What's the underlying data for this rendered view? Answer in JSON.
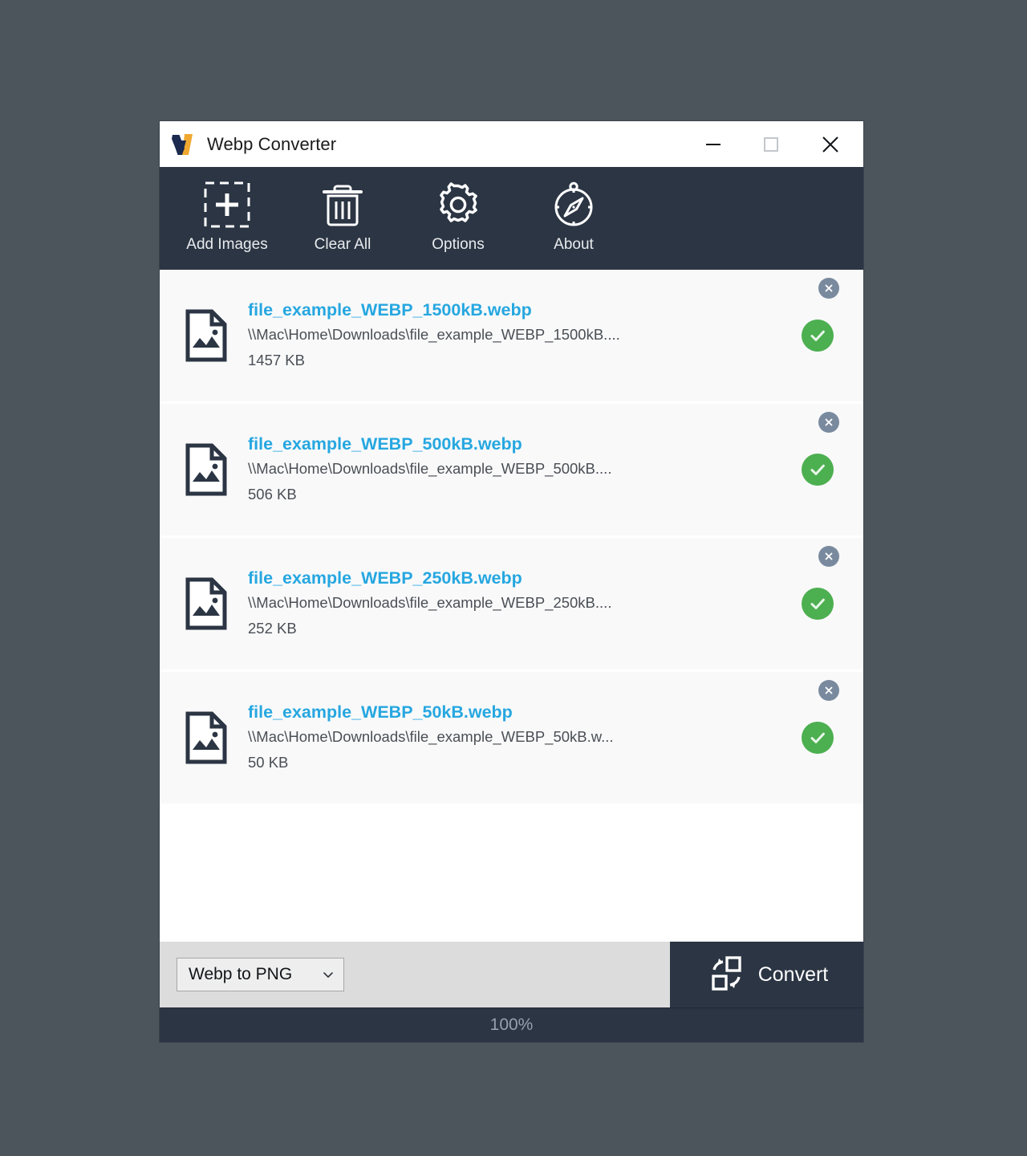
{
  "window": {
    "title": "Webp Converter",
    "logo_icon": "webp-converter-logo",
    "controls": [
      {
        "name": "minimize",
        "icon": "minimize-icon"
      },
      {
        "name": "maximize",
        "icon": "maximize-icon"
      },
      {
        "name": "close",
        "icon": "close-icon"
      }
    ]
  },
  "colors": {
    "toolbar_background": "#2b3543",
    "desktop_background": "#4c545c",
    "accent_link": "#26a7e0",
    "status_success": "#4caf50",
    "remove_badge": "#7a8a9e",
    "logo_orange": "#f0a830",
    "logo_navy": "#1b2a4e"
  },
  "toolbar": {
    "buttons": [
      {
        "label": "Add Images",
        "icon": "add-images-icon"
      },
      {
        "label": "Clear All",
        "icon": "trash-icon"
      },
      {
        "label": "Options",
        "icon": "gear-icon"
      },
      {
        "label": "About",
        "icon": "compass-icon"
      }
    ]
  },
  "file_list": {
    "rows": [
      {
        "name": "file_example_WEBP_1500kB.webp",
        "path": "\\\\Mac\\Home\\Downloads\\file_example_WEBP_1500kB....",
        "size": "1457 KB",
        "status": "success",
        "status_icon": "check-icon",
        "file_icon": "image-file-icon",
        "remove_icon": "remove-icon"
      },
      {
        "name": "file_example_WEBP_500kB.webp",
        "path": "\\\\Mac\\Home\\Downloads\\file_example_WEBP_500kB....",
        "size": "506 KB",
        "status": "success",
        "status_icon": "check-icon",
        "file_icon": "image-file-icon",
        "remove_icon": "remove-icon"
      },
      {
        "name": "file_example_WEBP_250kB.webp",
        "path": "\\\\Mac\\Home\\Downloads\\file_example_WEBP_250kB....",
        "size": "252 KB",
        "status": "success",
        "status_icon": "check-icon",
        "file_icon": "image-file-icon",
        "remove_icon": "remove-icon"
      },
      {
        "name": "file_example_WEBP_50kB.webp",
        "path": "\\\\Mac\\Home\\Downloads\\file_example_WEBP_50kB.w...",
        "size": "50 KB",
        "status": "success",
        "status_icon": "check-icon",
        "file_icon": "image-file-icon",
        "remove_icon": "remove-icon"
      }
    ]
  },
  "bottom_bar": {
    "format_select": {
      "value": "Webp to PNG",
      "chevron_icon": "chevron-down-icon"
    },
    "convert": {
      "label": "Convert",
      "icon": "convert-icon"
    }
  },
  "progress": {
    "percent_label": "100%",
    "percent_value": 100
  }
}
